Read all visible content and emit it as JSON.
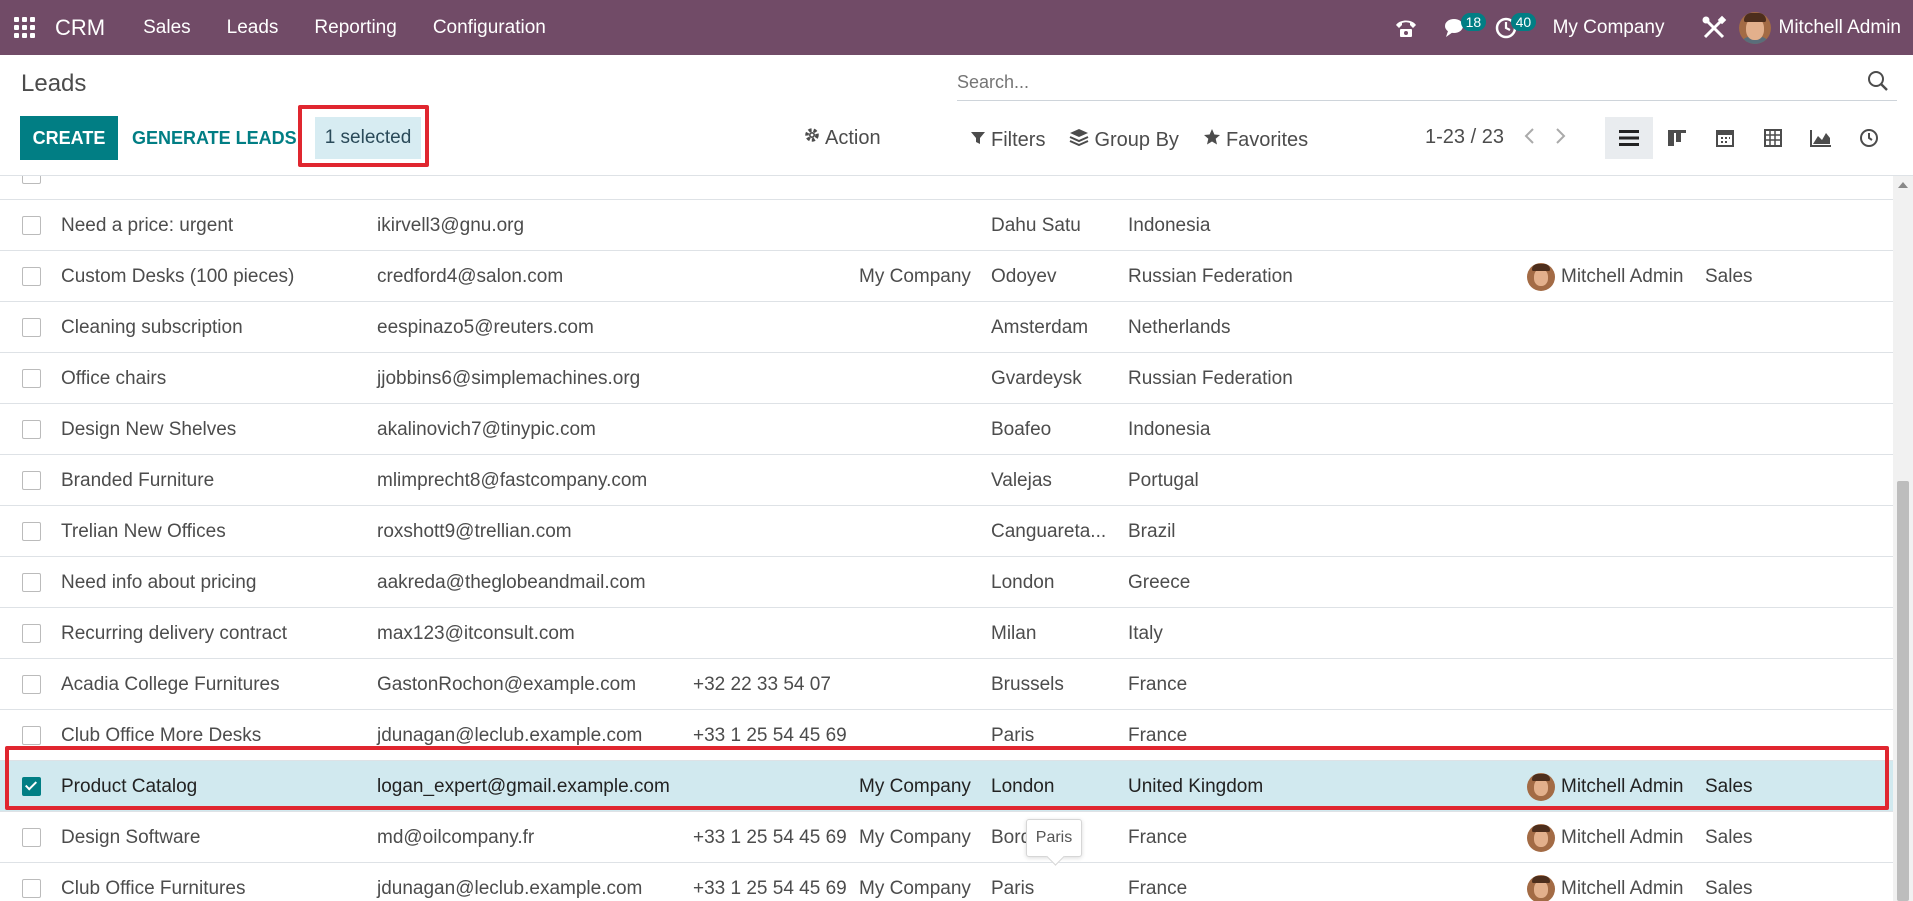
{
  "navbar": {
    "brand": "CRM",
    "menu": [
      "Sales",
      "Leads",
      "Reporting",
      "Configuration"
    ],
    "messages_count": "18",
    "activities_count": "40",
    "company": "My Company",
    "user": "Mitchell Admin"
  },
  "control_panel": {
    "title": "Leads",
    "search_placeholder": "Search...",
    "create_label": "CREATE",
    "generate_label": "GENERATE LEADS",
    "selected_label": "1 selected",
    "action_label": "Action",
    "filters_label": "Filters",
    "groupby_label": "Group By",
    "favorites_label": "Favorites",
    "pager_value": "1-23 / 23"
  },
  "rows": [
    {
      "name": "Need a price: urgent",
      "email": "ikirvell3@gnu.org",
      "phone": "",
      "company": "",
      "city": "Dahu Satu",
      "country": "Indonesia",
      "salesperson": "",
      "team": "",
      "selected": false
    },
    {
      "name": "Custom Desks (100 pieces)",
      "email": "credford4@salon.com",
      "phone": "",
      "company": "My Company",
      "city": "Odoyev",
      "country": "Russian Federation",
      "salesperson": "Mitchell Admin",
      "team": "Sales",
      "selected": false
    },
    {
      "name": "Cleaning subscription",
      "email": "eespinazo5@reuters.com",
      "phone": "",
      "company": "",
      "city": "Amsterdam",
      "country": "Netherlands",
      "salesperson": "",
      "team": "",
      "selected": false
    },
    {
      "name": "Office chairs",
      "email": "jjobbins6@simplemachines.org",
      "phone": "",
      "company": "",
      "city": "Gvardeysk",
      "country": "Russian Federation",
      "salesperson": "",
      "team": "",
      "selected": false
    },
    {
      "name": "Design New Shelves",
      "email": "akalinovich7@tinypic.com",
      "phone": "",
      "company": "",
      "city": "Boafeo",
      "country": "Indonesia",
      "salesperson": "",
      "team": "",
      "selected": false
    },
    {
      "name": "Branded Furniture",
      "email": "mlimprecht8@fastcompany.com",
      "phone": "",
      "company": "",
      "city": "Valejas",
      "country": "Portugal",
      "salesperson": "",
      "team": "",
      "selected": false
    },
    {
      "name": "Trelian New Offices",
      "email": "roxshott9@trellian.com",
      "phone": "",
      "company": "",
      "city": "Canguareta...",
      "country": "Brazil",
      "salesperson": "",
      "team": "",
      "selected": false
    },
    {
      "name": "Need info about pricing",
      "email": "aakreda@theglobeandmail.com",
      "phone": "",
      "company": "",
      "city": "London",
      "country": "Greece",
      "salesperson": "",
      "team": "",
      "selected": false
    },
    {
      "name": "Recurring delivery contract",
      "email": "max123@itconsult.com",
      "phone": "",
      "company": "",
      "city": "Milan",
      "country": "Italy",
      "salesperson": "",
      "team": "",
      "selected": false
    },
    {
      "name": "Acadia College Furnitures",
      "email": "GastonRochon@example.com",
      "phone": "+32 22 33 54 07",
      "company": "",
      "city": "Brussels",
      "country": "France",
      "salesperson": "",
      "team": "",
      "selected": false
    },
    {
      "name": "Club Office More Desks",
      "email": "jdunagan@leclub.example.com",
      "phone": "+33 1 25 54 45 69",
      "company": "",
      "city": "Paris",
      "country": "France",
      "salesperson": "",
      "team": "",
      "selected": false
    },
    {
      "name": "Product Catalog",
      "email": "logan_expert@gmail.example.com",
      "phone": "",
      "company": "My Company",
      "city": "London",
      "country": "United Kingdom",
      "salesperson": "Mitchell Admin",
      "team": "Sales",
      "selected": true
    },
    {
      "name": "Design Software",
      "email": "md@oilcompany.fr",
      "phone": "+33 1 25 54 45 69",
      "company": "My Company",
      "city": "Bord",
      "country": "France",
      "salesperson": "Mitchell Admin",
      "team": "Sales",
      "selected": false
    },
    {
      "name": "Club Office Furnitures",
      "email": "jdunagan@leclub.example.com",
      "phone": "+33 1 25 54 45 69",
      "company": "My Company",
      "city": "Paris",
      "country": "France",
      "salesperson": "Mitchell Admin",
      "team": "Sales",
      "selected": false
    }
  ],
  "tooltip": "Paris",
  "colors": {
    "navbar": "#714b67",
    "primary": "#017e84",
    "highlight": "#e0262f",
    "selected_row": "#d1e9ef"
  }
}
